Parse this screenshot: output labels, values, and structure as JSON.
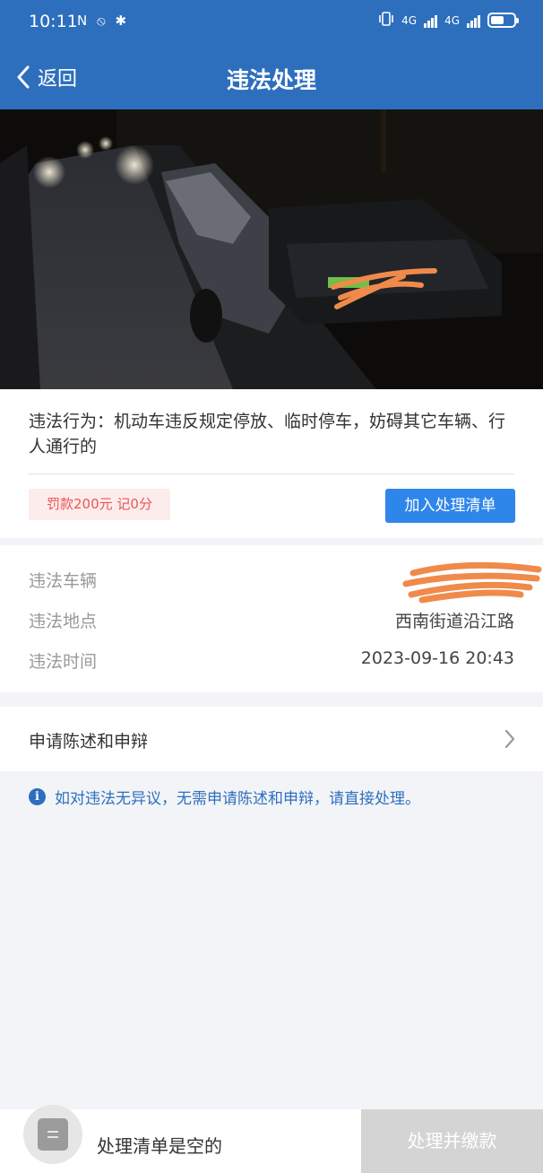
{
  "status_bar": {
    "time": "10:11",
    "left_icons": "N ⦸ ✱",
    "network_1": "4G",
    "network_2": "4G"
  },
  "nav": {
    "back_label": "返回",
    "title": "违法处理"
  },
  "violation": {
    "description": "违法行为：机动车违反规定停放、临时停车，妨碍其它车辆、行人通行的",
    "penalty": "罚款200元 记0分",
    "add_button": "加入处理清单"
  },
  "details": {
    "vehicle_label": "违法车辆",
    "vehicle_value": "",
    "location_label": "违法地点",
    "location_value": "西南街道沿江路",
    "time_label": "违法时间",
    "time_value": "2023-09-16 20:43"
  },
  "appeal": {
    "label": "申请陈述和申辩"
  },
  "notice": {
    "text": "如对违法无异议，无需申请陈述和申辩，请直接处理。"
  },
  "bottom": {
    "empty_text": "处理清单是空的",
    "pay_button": "处理并缴款"
  },
  "colors": {
    "primary": "#2d6fbd",
    "button_blue": "#2f86ea",
    "penalty_red": "#ea5555",
    "disabled_gray": "#d4d4d4",
    "redaction_orange": "#f08a4b"
  }
}
